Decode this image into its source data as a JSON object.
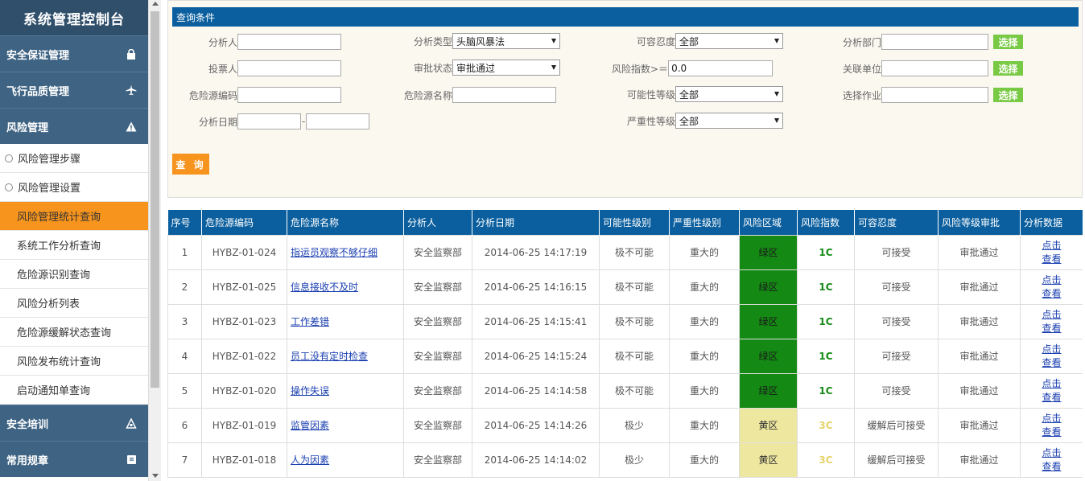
{
  "sidebar": {
    "title": "系统管理控制台",
    "sections": {
      "safety": "安全保证管理",
      "flight": "飞行品质管理",
      "risk": "风险管理",
      "training": "安全培训",
      "rules": "常用规章"
    },
    "risk_items": [
      "风险管理步骤",
      "风险管理设置",
      "风险管理统计查询",
      "系统工作分析查询",
      "危险源识别查询",
      "风险分析列表",
      "危险源缓解状态查询",
      "风险发布统计查询",
      "启动通知单查询"
    ]
  },
  "query": {
    "header": "查询条件",
    "analyst_label": "分析人",
    "analyst_value": "",
    "analysis_type_label": "分析类型",
    "analysis_type_value": "头脑风暴法",
    "tolerance_label": "可容忍度",
    "tolerance_value": "全部",
    "dept_label": "分析部门",
    "dept_value": "",
    "voter_label": "投票人",
    "voter_value": "",
    "approval_label": "审批状态",
    "approval_value": "审批通过",
    "risk_index_label": "风险指数>＝",
    "risk_index_value": "0.0",
    "unit_label": "关联单位",
    "unit_value": "",
    "hazard_code_label": "危险源编码",
    "hazard_code_value": "",
    "hazard_name_label": "危险源名称",
    "hazard_name_value": "",
    "likelihood_label": "可能性等级",
    "likelihood_value": "全部",
    "job_label": "选择作业",
    "job_value": "",
    "date_label": "分析日期",
    "date_sep": "-",
    "severity_label": "严重性等级",
    "severity_value": "全部",
    "choose_label": "选择",
    "search_label": "查 询"
  },
  "table": {
    "headers": [
      "序号",
      "危险源编码",
      "危险源名称",
      "分析人",
      "分析日期",
      "可能性级别",
      "严重性级别",
      "风险区域",
      "风险指数",
      "可容忍度",
      "风险等级审批",
      "分析数据"
    ],
    "view_line1": "点击",
    "view_line2": "查看",
    "rows": [
      {
        "no": "1",
        "code": "HYBZ-01-024",
        "name": "指运员观察不够仔细",
        "analyst": "安全监察部",
        "date": "2014-06-25 14:17:19",
        "likelihood": "极不可能",
        "severity": "重大的",
        "zone": "绿区",
        "index": "1C",
        "tolerance": "可接受",
        "approval": "审批通过"
      },
      {
        "no": "2",
        "code": "HYBZ-01-025",
        "name": "信息接收不及时",
        "analyst": "安全监察部",
        "date": "2014-06-25 14:16:15",
        "likelihood": "极不可能",
        "severity": "重大的",
        "zone": "绿区",
        "index": "1C",
        "tolerance": "可接受",
        "approval": "审批通过"
      },
      {
        "no": "3",
        "code": "HYBZ-01-023",
        "name": "工作差错",
        "analyst": "安全监察部",
        "date": "2014-06-25 14:15:41",
        "likelihood": "极不可能",
        "severity": "重大的",
        "zone": "绿区",
        "index": "1C",
        "tolerance": "可接受",
        "approval": "审批通过"
      },
      {
        "no": "4",
        "code": "HYBZ-01-022",
        "name": "员工没有定时检查",
        "analyst": "安全监察部",
        "date": "2014-06-25 14:15:24",
        "likelihood": "极不可能",
        "severity": "重大的",
        "zone": "绿区",
        "index": "1C",
        "tolerance": "可接受",
        "approval": "审批通过"
      },
      {
        "no": "5",
        "code": "HYBZ-01-020",
        "name": "操作失误",
        "analyst": "安全监察部",
        "date": "2014-06-25 14:14:58",
        "likelihood": "极不可能",
        "severity": "重大的",
        "zone": "绿区",
        "index": "1C",
        "tolerance": "可接受",
        "approval": "审批通过"
      },
      {
        "no": "6",
        "code": "HYBZ-01-019",
        "name": "监管因素",
        "analyst": "安全监察部",
        "date": "2014-06-25 14:14:26",
        "likelihood": "极少",
        "severity": "重大的",
        "zone": "黄区",
        "index": "3C",
        "tolerance": "缓解后可接受",
        "approval": "审批通过"
      },
      {
        "no": "7",
        "code": "HYBZ-01-018",
        "name": "人为因素",
        "analyst": "安全监察部",
        "date": "2014-06-25 14:14:02",
        "likelihood": "极少",
        "severity": "重大的",
        "zone": "黄区",
        "index": "3C",
        "tolerance": "缓解后可接受",
        "approval": "审批通过"
      }
    ]
  },
  "colors": {
    "sidebar_section": "#3e6383",
    "sidebar_title": "#2f4f6a",
    "active_item": "#f7941d",
    "header_blue": "#0b5f9e",
    "choose_green": "#78c943",
    "zone_green": "#148a14",
    "zone_yellow": "#eee79f"
  }
}
